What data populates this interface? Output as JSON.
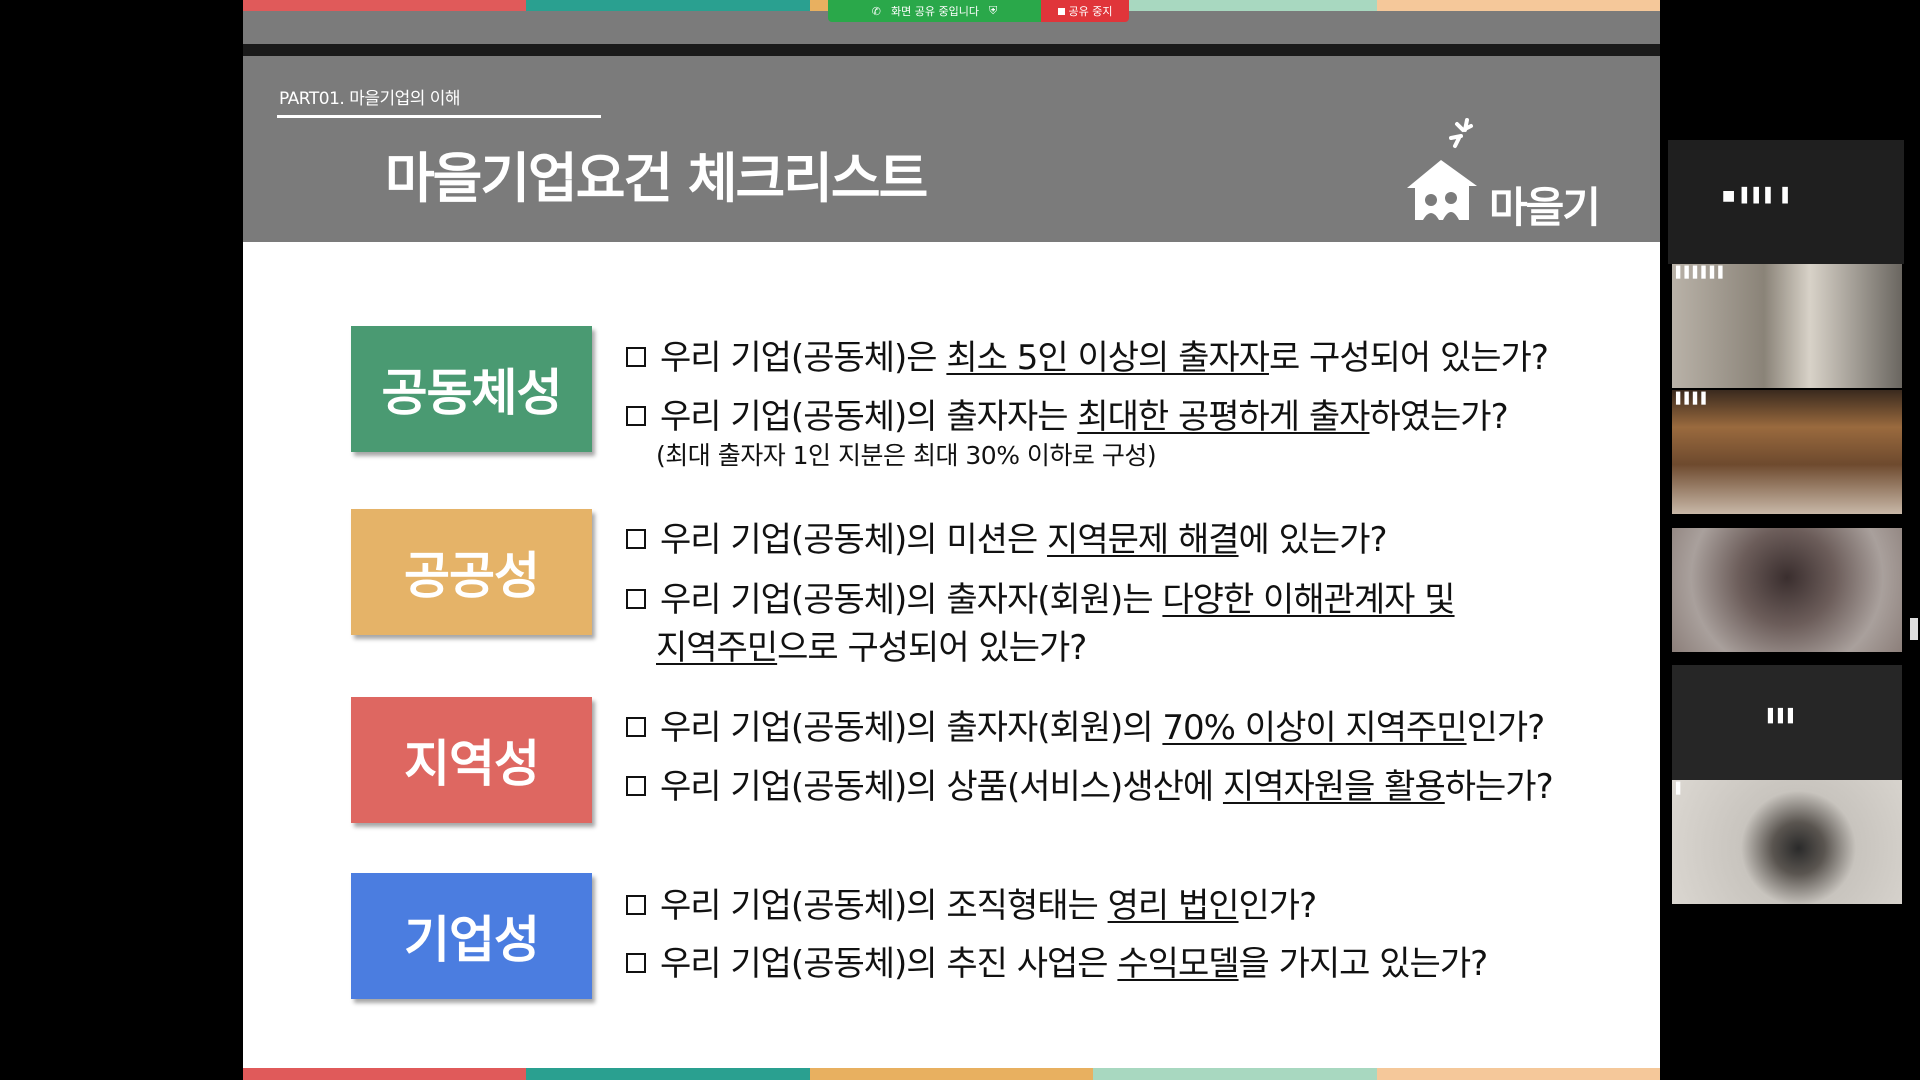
{
  "share_banner": {
    "status": "화면 공유 중입니다",
    "stop": "공유 중지"
  },
  "slide": {
    "part_label": "PART01. 마을기업의 이해",
    "title": "마을기업요건 체크리스트",
    "logo_text": "마을기업",
    "stripe_colors": [
      "#e05a5a",
      "#2aa090",
      "#e8b060",
      "#a8d8c0",
      "#f5c89a"
    ],
    "criteria": [
      {
        "label": "공동체성",
        "color": "#4a9a72",
        "questions": [
          {
            "pre": "우리 기업(공동체)은 ",
            "u": "최소 5인 이상의 출자자",
            "post": "로 구성되어 있는가?"
          },
          {
            "pre": "우리 기업(공동체)의 출자자는 ",
            "u": "최대한 공평하게 출자",
            "post": "하였는가?"
          }
        ],
        "note": "(최대 출자자 1인 지분은 최대 30% 이하로 구성)"
      },
      {
        "label": "공공성",
        "color": "#e5b368",
        "questions": [
          {
            "pre": "우리 기업(공동체)의 미션은 ",
            "u": "지역문제 해결",
            "post": "에 있는가?"
          },
          {
            "pre": "우리 기업(공동체)의 출자자(회원)는 ",
            "u": "다양한 이해관계자 및",
            "post": ""
          }
        ],
        "continuation": {
          "u": "지역주민",
          "post": "으로 구성되어 있는가?"
        }
      },
      {
        "label": "지역성",
        "color": "#de6761",
        "questions": [
          {
            "pre": "우리 기업(공동체)의 출자자(회원)의 ",
            "u": "70% 이상이 지역주민",
            "post": "인가?"
          },
          {
            "pre": "우리 기업(공동체)의 상품(서비스)생산에 ",
            "u": "지역자원을 활용",
            "post": "하는가?"
          }
        ]
      },
      {
        "label": "기업성",
        "color": "#4b7de0",
        "questions": [
          {
            "pre": "우리 기업(공동체)의 조직형태는 ",
            "u": "영리 법인",
            "post": "인가?"
          },
          {
            "pre": "우리 기업(공동체)의 추진 사업은 ",
            "u": "수익모델",
            "post": "을 가지고 있는가?"
          }
        ]
      }
    ]
  },
  "participants": {
    "header_label": "■ ▌▌▌ ▌",
    "tiles": [
      {
        "name": "▌▌▌▌▌▌",
        "tone": "#8a8378"
      },
      {
        "name": "▌▌▌▌",
        "tone": "#6e4a2e"
      },
      {
        "name": "",
        "tone": "#8c7f7a"
      },
      {
        "name": "▌▌▌",
        "tone": "#2a2a2a"
      },
      {
        "name": "▌",
        "tone": "#c8c4be"
      }
    ]
  }
}
